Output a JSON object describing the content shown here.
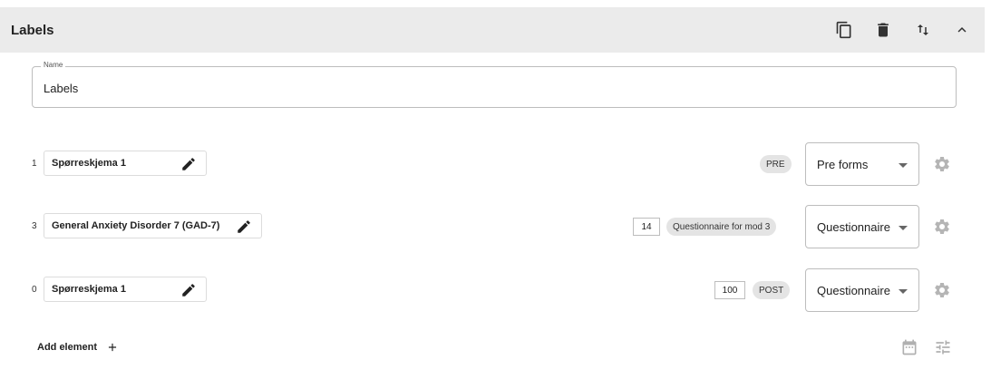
{
  "section": {
    "title": "Labels",
    "actions": [
      "copy-icon",
      "delete-icon",
      "sort-icon",
      "collapse-icon"
    ]
  },
  "name_field": {
    "label": "Name",
    "value": "Labels"
  },
  "rows": [
    {
      "index": "1",
      "title": "Spørreskjema 1",
      "number": "",
      "chip": "PRE",
      "select": "Pre forms"
    },
    {
      "index": "3",
      "title": "General Anxiety Disorder 7 (GAD-7)",
      "number": "14",
      "chip": "Questionnaire for mod 3",
      "select": "Questionnaire"
    },
    {
      "index": "0",
      "title": "Spørreskjema 1",
      "number": "100",
      "chip": "POST",
      "select": "Questionnaire"
    }
  ],
  "add_element": {
    "label": "Add element"
  },
  "colors": {
    "header_bg": "#ebebeb",
    "icon_dark": "#2b2b2b",
    "icon_muted": "#9e9e9e",
    "chip_bg": "#e4e4e4"
  }
}
